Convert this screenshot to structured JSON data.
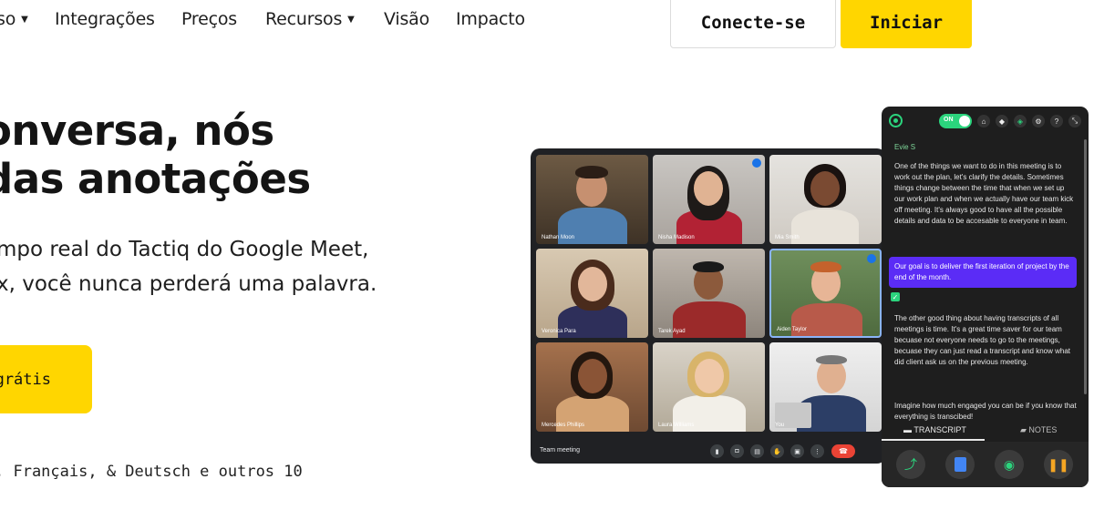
{
  "nav": {
    "items": [
      "so",
      "Integrações",
      "Preços",
      "Recursos",
      "Visão",
      "Impacto"
    ],
    "login_label": "Conecte-se",
    "start_label": "Iniciar"
  },
  "hero": {
    "heading_line1": "onversa, nós",
    "heading_line2": "das anotações",
    "sub_line1": "mpo real do Tactiq do Google Meet,",
    "sub_line2": "x, você nunca perderá uma palavra.",
    "cta_label": "grátis",
    "languages": ", Français, & Deutsch e outros 10"
  },
  "meet": {
    "participants": [
      "Nathan Moon",
      "Nisha Madison",
      "Mia Smith",
      "Veronica Para",
      "Tarek Ayad",
      "Aiden Taylor",
      "Mercedes Phillips",
      "Laura Williams",
      "You"
    ],
    "meeting_title": "Team meeting",
    "controls": [
      "mic-icon",
      "camera-icon",
      "captions-icon",
      "hand-icon",
      "present-icon",
      "more-icon"
    ],
    "end_call_icon": "end-call-icon"
  },
  "tactiq": {
    "toggle_label": "ON",
    "speaker": "Evie S",
    "paragraph1": "One of the things we want to do in this meeting is to work out the plan, let's clarify the details. Sometimes things change between the time that when we set up our work plan and when we actually have our team kick off meeting. It's always good to have all the possible details and data to be accesable to everyone in team.",
    "highlight": "Our goal is to deliver the first iteration of project by the end of the month.",
    "check": "✓",
    "paragraph2": "The other good thing about having transcripts of all meetings is time. It's a great time saver for our team becuase not everyone needs to go to the meetings, becuase they can just read a transcript and know what did client ask us on the previous meeting.",
    "paragraph3": "Imagine how much engaged you can be if you know that everything is transcibed!",
    "tab_transcript": "TRANSCRIPT",
    "tab_notes": "NOTES",
    "colors": {
      "accent_green": "#2bd47d",
      "highlight_purple": "#5b2cf6",
      "brand_yellow": "#ffd600"
    }
  }
}
